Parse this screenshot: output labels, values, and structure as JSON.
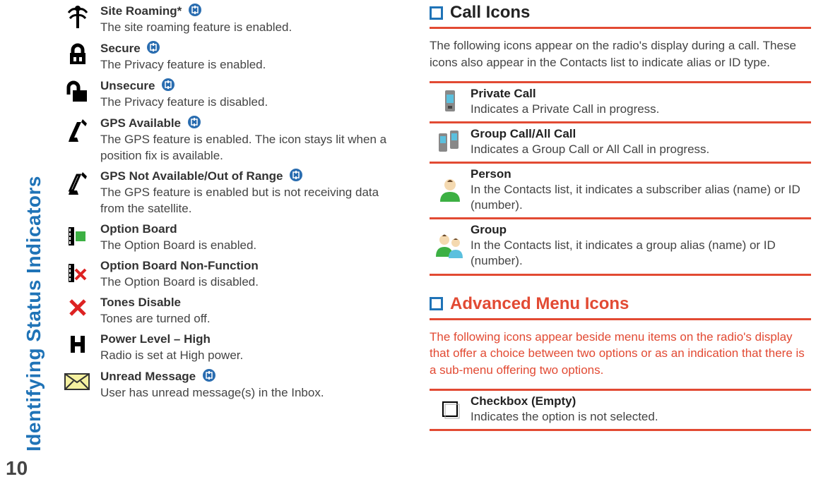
{
  "sidebar_label": "Identifying Status Indicators",
  "page_number": "10",
  "left_items": [
    {
      "title": "Site Roaming*",
      "desc": "The site roaming feature is enabled.",
      "badge": true
    },
    {
      "title": "Secure",
      "desc": "The Privacy feature is enabled.",
      "badge": true
    },
    {
      "title": "Unsecure",
      "desc": "The Privacy feature is disabled.",
      "badge": true
    },
    {
      "title": "GPS Available",
      "desc": "The GPS feature is enabled. The icon stays lit when a position fix is available.",
      "badge": true
    },
    {
      "title": "GPS Not Available/Out of Range",
      "desc": "The GPS feature is enabled but is not receiving data from the satellite.",
      "badge": true
    },
    {
      "title": "Option Board",
      "desc": "The Option Board is enabled.",
      "badge": false
    },
    {
      "title": "Option Board Non-Function",
      "desc": "The Option Board is disabled.",
      "badge": false
    },
    {
      "title": "Tones Disable",
      "desc": "Tones are turned off.",
      "badge": false
    },
    {
      "title": "Power Level – High",
      "desc": "Radio is set at High power.",
      "badge": false
    },
    {
      "title": "Unread Message",
      "desc": "User has unread message(s) in the Inbox.",
      "badge": true
    }
  ],
  "section_call_icons": {
    "title": "Call Icons",
    "intro": "The following icons appear on the radio's display during a call. These icons also appear in the Contacts list to indicate alias or ID type.",
    "rows": [
      {
        "title": "Private Call",
        "desc": "Indicates a Private Call in progress."
      },
      {
        "title": "Group Call/All Call",
        "desc": "Indicates a Group Call or All Call in progress."
      },
      {
        "title": "Person",
        "desc": "In the Contacts list, it indicates a subscriber alias (name) or ID (number)."
      },
      {
        "title": "Group",
        "desc": "In the Contacts list, it indicates a group alias (name) or ID (number)."
      }
    ]
  },
  "section_adv_menu": {
    "title": "Advanced Menu Icons",
    "intro": "The following icons appear beside menu items on the radio's display that offer a choice between two options or as an indication that there is a sub-menu offering two options.",
    "rows": [
      {
        "title": "Checkbox (Empty)",
        "desc": "Indicates the option is not selected."
      }
    ]
  }
}
